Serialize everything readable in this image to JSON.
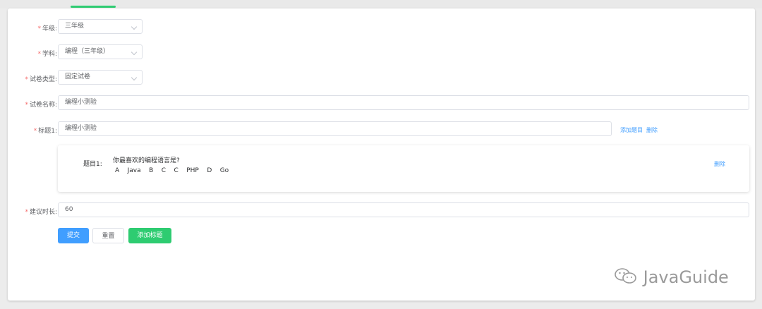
{
  "form": {
    "grade": {
      "label": "年级:",
      "value": "三年级"
    },
    "subject": {
      "label": "学科:",
      "value": "编程（三年级）"
    },
    "paper_type": {
      "label": "试卷类型:",
      "value": "固定试卷"
    },
    "paper_name": {
      "label": "试卷名称:",
      "value": "编程小测验"
    },
    "title1": {
      "label": "标题1:",
      "value": "编程小测验",
      "add_question": "添加题目",
      "delete": "删除"
    },
    "question": {
      "label": "题目1:",
      "text": "你最喜欢的编程语言是?",
      "options": [
        {
          "key": "A",
          "text": "Java"
        },
        {
          "key": "B",
          "text": "C"
        },
        {
          "key": "C",
          "text": "PHP"
        },
        {
          "key": "D",
          "text": "Go"
        }
      ],
      "delete": "删除"
    },
    "duration": {
      "label": "建议时长:",
      "value": "60"
    },
    "required_mark": "*"
  },
  "buttons": {
    "submit": "提交",
    "reset": "重置",
    "add_title": "添加标题"
  },
  "watermark": {
    "icon": "wechat-icon",
    "text": "JavaGuide"
  },
  "colors": {
    "primary": "#409eff",
    "success": "#2ecc71",
    "required": "#f56c6c",
    "link": "#409eff"
  }
}
